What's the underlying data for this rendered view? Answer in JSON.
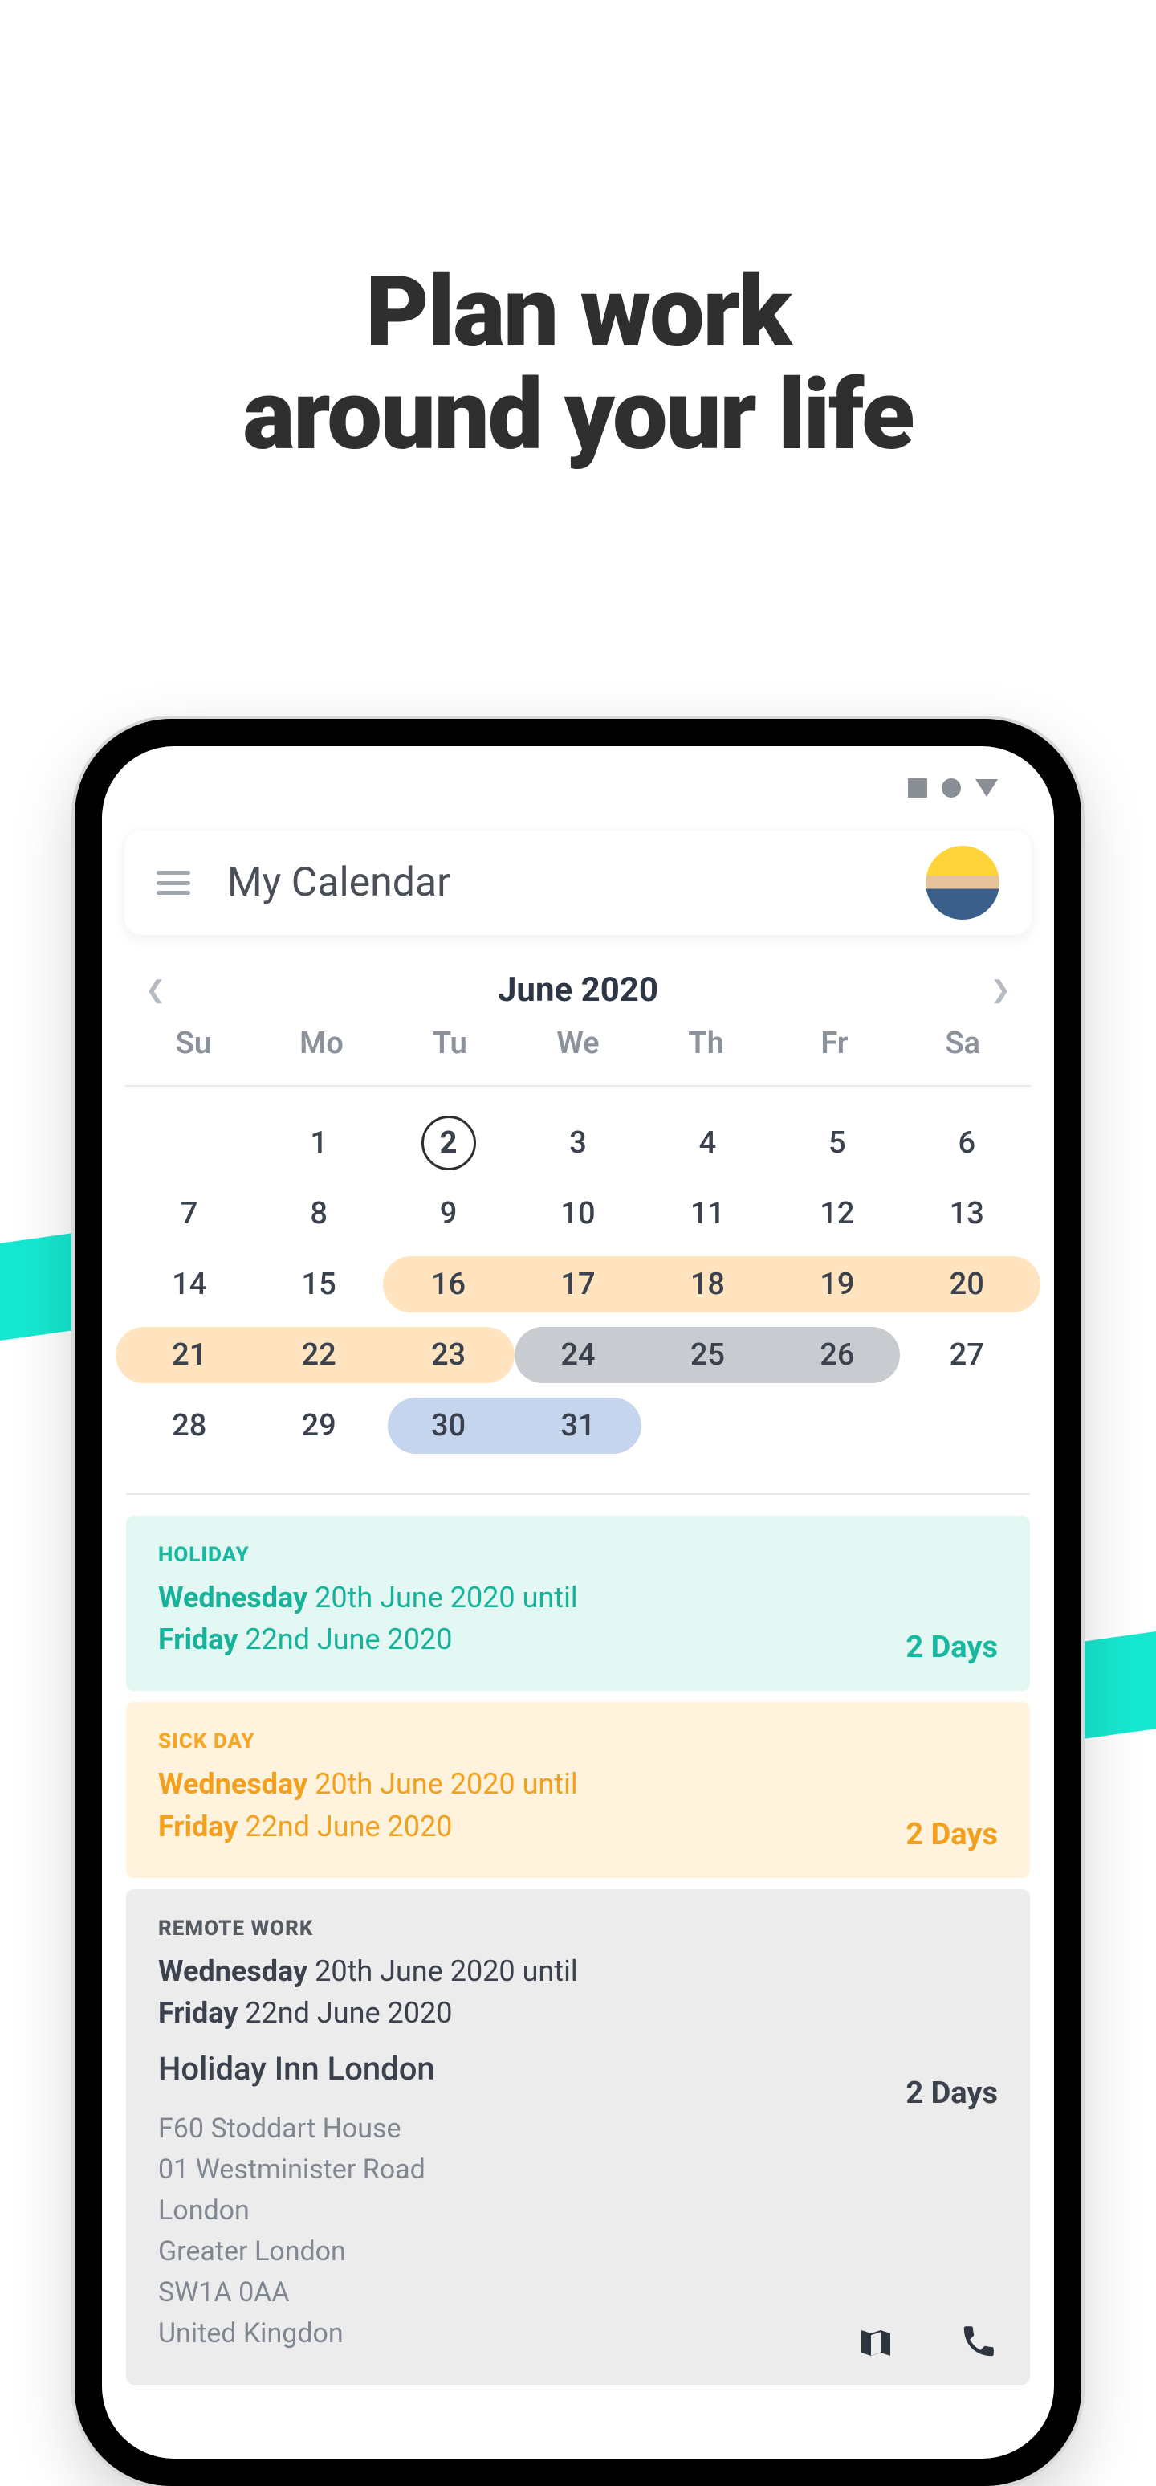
{
  "headline_line1": "Plan work",
  "headline_line2": "around your life",
  "topbar": {
    "title": "My Calendar"
  },
  "month": {
    "label": "June 2020"
  },
  "dow": [
    "Su",
    "Mo",
    "Tu",
    "We",
    "Th",
    "Fr",
    "Sa"
  ],
  "weeks": [
    [
      "",
      "1",
      "2",
      "3",
      "4",
      "5",
      "6"
    ],
    [
      "7",
      "8",
      "9",
      "10",
      "11",
      "12",
      "13"
    ],
    [
      "14",
      "15",
      "16",
      "17",
      "18",
      "19",
      "20"
    ],
    [
      "21",
      "22",
      "23",
      "24",
      "25",
      "26",
      "27"
    ],
    [
      "28",
      "29",
      "30",
      "31",
      "",
      "",
      ""
    ]
  ],
  "selected_day": "2",
  "events": {
    "holiday": {
      "tag": "HOLIDAY",
      "l1_bold": "Wednesday",
      "l1_rest": " 20th June 2020 until",
      "l2_bold": "Friday",
      "l2_rest": " 22nd June 2020",
      "days": "2 Days"
    },
    "sick": {
      "tag": "SICK DAY",
      "l1_bold": "Wednesday",
      "l1_rest": " 20th June 2020 until",
      "l2_bold": "Friday",
      "l2_rest": " 22nd June 2020",
      "days": "2 Days"
    },
    "remote": {
      "tag": "REMOTE WORK",
      "l1_bold": "Wednesday",
      "l1_rest": " 20th June 2020 until",
      "l2_bold": "Friday",
      "l2_rest": " 22nd June 2020",
      "location": "Holiday Inn London",
      "addr1": "F60 Stoddart House",
      "addr2": "01 Westminister Road",
      "addr3": "London",
      "addr4": "Greater London",
      "addr5": "SW1A 0AA",
      "addr6": "United Kingdon",
      "days": "2 Days"
    }
  }
}
